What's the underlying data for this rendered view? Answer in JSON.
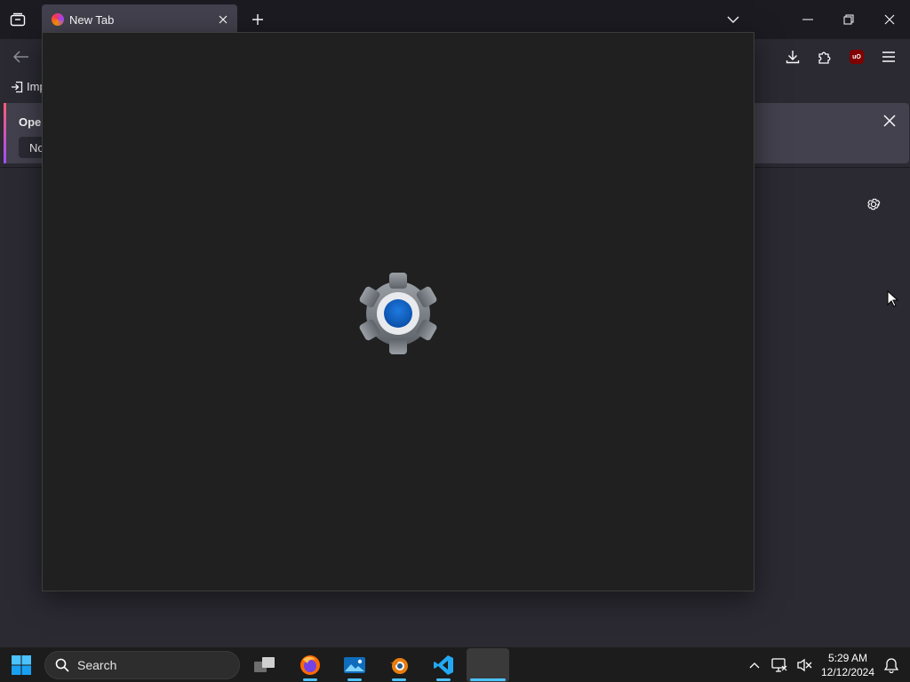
{
  "browser": {
    "tab": {
      "title": "New Tab"
    },
    "bookmarks": {
      "import_label": "Imp"
    },
    "notification": {
      "message": "Open",
      "button_label": "Not"
    }
  },
  "colors": {
    "tab_active": "#42414d",
    "chrome_dark": "#1c1b22",
    "splash_bg": "#202020",
    "accent_blue": "#4cc2ff",
    "ublock_red": "#800000"
  },
  "icons": {
    "tab_list": "tab-list-icon",
    "new_tab": "plus-icon",
    "back": "arrow-left-icon",
    "downloads": "download-icon",
    "extensions": "puzzle-icon",
    "ublock": "ublock-origin-icon",
    "menu": "hamburger-icon",
    "settings_splash": "windows-settings-gear-icon"
  },
  "ublock_badge": "uO",
  "taskbar": {
    "search_placeholder": "Search",
    "apps": [
      "Task View",
      "Firefox",
      "Photos",
      "Blender",
      "Visual Studio Code",
      "Settings"
    ],
    "clock": {
      "time": "5:29 AM",
      "date": "12/12/2024"
    }
  }
}
